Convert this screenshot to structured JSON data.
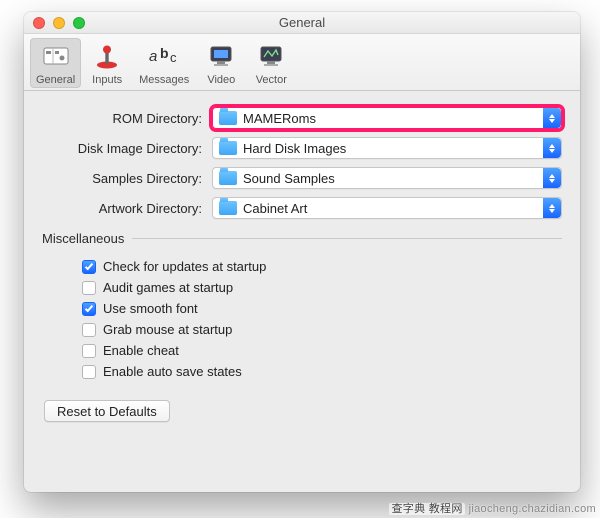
{
  "window": {
    "title": "General"
  },
  "toolbar": {
    "items": [
      {
        "key": "general",
        "label": "General"
      },
      {
        "key": "inputs",
        "label": "Inputs"
      },
      {
        "key": "messages",
        "label": "Messages"
      },
      {
        "key": "video",
        "label": "Video"
      },
      {
        "key": "vector",
        "label": "Vector"
      }
    ]
  },
  "dirs": {
    "rom": {
      "label": "ROM Directory:",
      "value": "MAMERoms"
    },
    "disk": {
      "label": "Disk Image Directory:",
      "value": "Hard Disk Images"
    },
    "samples": {
      "label": "Samples Directory:",
      "value": "Sound Samples"
    },
    "artwork": {
      "label": "Artwork Directory:",
      "value": "Cabinet Art"
    }
  },
  "misc": {
    "heading": "Miscellaneous",
    "items": [
      {
        "label": "Check for updates at startup",
        "checked": true
      },
      {
        "label": "Audit games at startup",
        "checked": false
      },
      {
        "label": "Use smooth font",
        "checked": true
      },
      {
        "label": "Grab mouse at startup",
        "checked": false
      },
      {
        "label": "Enable cheat",
        "checked": false
      },
      {
        "label": "Enable auto save states",
        "checked": false
      }
    ]
  },
  "buttons": {
    "reset": "Reset to Defaults"
  },
  "watermark": {
    "zh": "查字典 教程网",
    "url": "jiaocheng.chazidian.com"
  }
}
